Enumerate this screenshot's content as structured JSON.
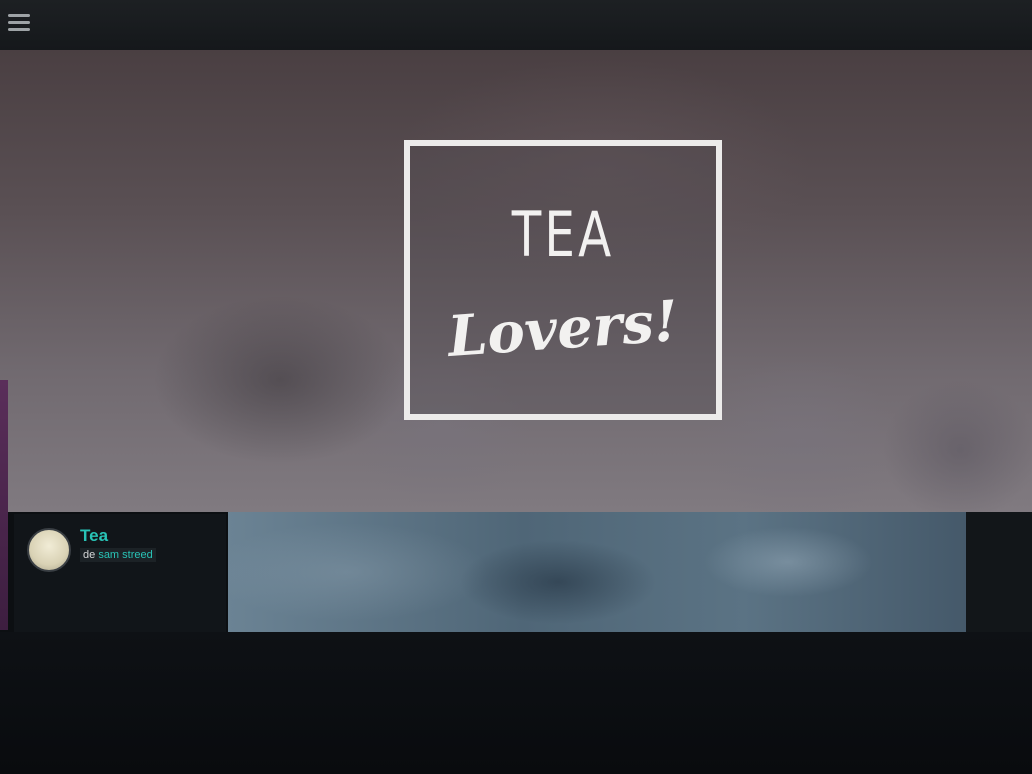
{
  "header": {
    "menu_icon": "hamburger-menu-icon"
  },
  "hero": {
    "logo_line1": "TEA",
    "logo_line2": "Lovers!"
  },
  "card": {
    "title": "Tea",
    "by_prefix": "de",
    "author": "sam streed",
    "accent_color": "#28c3b6"
  }
}
